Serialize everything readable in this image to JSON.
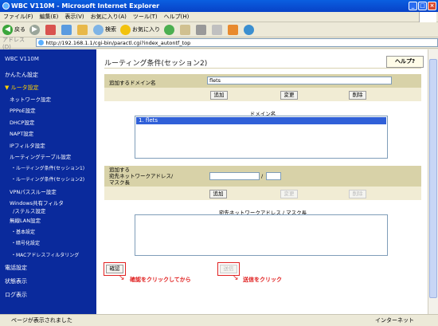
{
  "window": {
    "title": "WBC V110M - Microsoft Internet Explorer"
  },
  "menu": [
    "ファイル(F)",
    "編集(E)",
    "表示(V)",
    "お気に入り(A)",
    "ツール(T)",
    "ヘルプ(H)"
  ],
  "toolbar": {
    "back": "戻る",
    "search": "検索",
    "favorites": "お気に入り"
  },
  "address": {
    "label": "アドレス(D)",
    "url": "http://192.168.1.1/cgi-bin/paractl.cgi?index_autontf_top"
  },
  "sidebar": {
    "logo": "WBC V110M",
    "items": [
      "かんたん設定",
      "ルータ設定",
      "ネットワーク設定",
      "PPPoE設定",
      "DHCP設定",
      "NAPT設定",
      "IPフィルタ設定",
      "ルーティングテーブル設定",
      "・ルーティング条件(セッション1)",
      "・ルーティング条件(セッション2)",
      "VPNパススルー設定",
      "Windows共有フィルタ",
      "/ステルス設定",
      "無線LAN設定",
      "・基本設定",
      "・暗号化設定",
      "・MACアドレスフィルタリング",
      "電話設定",
      "状態表示",
      "ログ表示"
    ]
  },
  "page": {
    "title": "ルーティング条件(セッション2)",
    "help": "ヘルプ?",
    "domain_label": "追加するドメイン名",
    "domain_value": "flets",
    "btn_add": "追加",
    "btn_change": "変更",
    "btn_delete": "削除",
    "domain_list_header": "ドメイン名",
    "domain_list_item": "1. flets",
    "net_label_1": "追加する",
    "net_label_2": "宛先ネットワークアドレス/",
    "net_label_3": "マスク長",
    "slash": "/",
    "net_list_header": "宛先ネットワークアドレス / マスク長",
    "btn_confirm": "確認",
    "btn_send": "送信",
    "note_confirm": "確認をクリックしてから",
    "note_send": "送信をクリック"
  },
  "status": {
    "text": "ページが表示されました",
    "zone": "インターネット"
  }
}
